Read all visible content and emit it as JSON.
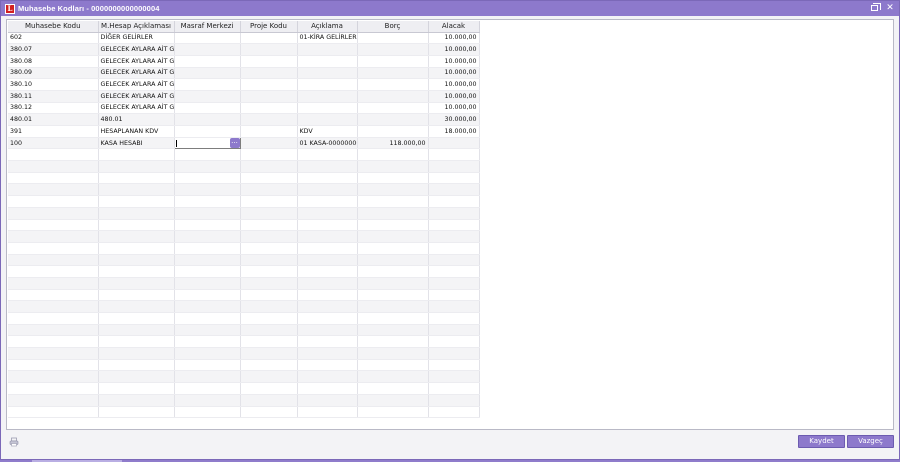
{
  "window": {
    "title": "Muhasebe Kodları - 0000000000000004",
    "app_icon_letter": "L",
    "accent_color": "#8d79cc"
  },
  "grid": {
    "columns": [
      "Muhasebe  Kodu",
      "M.Hesap Açıklaması",
      "Masraf Merkezi",
      "Proje Kodu",
      "Açıklama",
      "Borç",
      "Alacak"
    ],
    "rows": [
      [
        "602",
        "DİĞER GELİRLER",
        "",
        "",
        "01-KİRA GELİRLERİ",
        "",
        "10.000,00"
      ],
      [
        "380.07",
        "GELECEK AYLARA AİT GEL",
        "",
        "",
        "",
        "",
        "10.000,00"
      ],
      [
        "380.08",
        "GELECEK AYLARA AİT GEL",
        "",
        "",
        "",
        "",
        "10.000,00"
      ],
      [
        "380.09",
        "GELECEK AYLARA AİT GEL",
        "",
        "",
        "",
        "",
        "10.000,00"
      ],
      [
        "380.10",
        "GELECEK AYLARA AİT GEL",
        "",
        "",
        "",
        "",
        "10.000,00"
      ],
      [
        "380.11",
        "GELECEK AYLARA AİT GEL",
        "",
        "",
        "",
        "",
        "10.000,00"
      ],
      [
        "380.12",
        "GELECEK AYLARA AİT GEL",
        "",
        "",
        "",
        "",
        "10.000,00"
      ],
      [
        "480.01",
        "480.01",
        "",
        "",
        "",
        "",
        "30.000,00"
      ],
      [
        "391",
        "HESAPLANAN KDV",
        "",
        "",
        "KDV",
        "",
        "18.000,00"
      ],
      [
        "100",
        "KASA HESABI",
        "",
        "",
        "01 KASA-000000000",
        "118.000,00",
        ""
      ]
    ],
    "ellipsis_label": "..."
  },
  "footer": {
    "save_label": "Kaydet",
    "cancel_label": "Vazgeç"
  }
}
